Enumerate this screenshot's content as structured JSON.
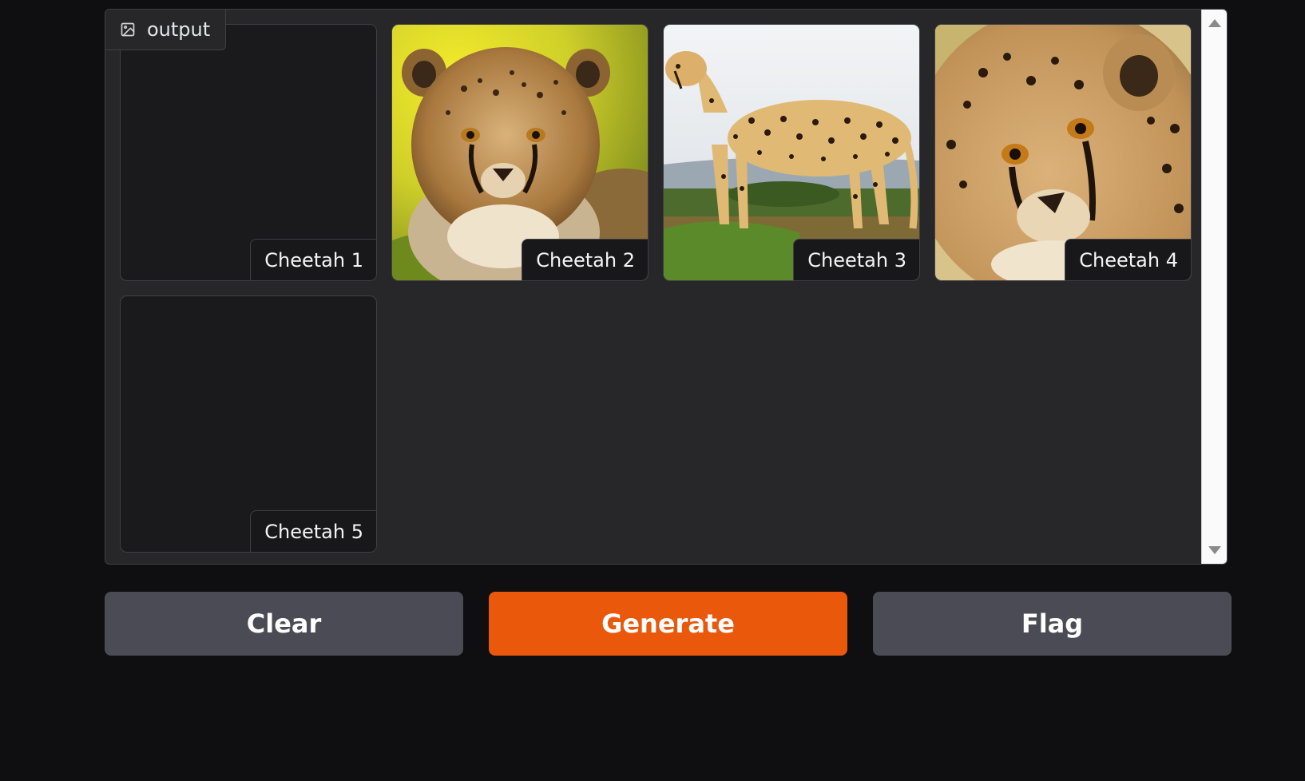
{
  "output_block": {
    "label": "output",
    "label_icon": "image-icon"
  },
  "gallery": {
    "items": [
      {
        "caption": "Cheetah 1",
        "has_image": false
      },
      {
        "caption": "Cheetah 2",
        "has_image": true,
        "image": "cheetah-cub-lying-in-grass"
      },
      {
        "caption": "Cheetah 3",
        "has_image": true,
        "image": "cheetah-standing-on-savanna"
      },
      {
        "caption": "Cheetah 4",
        "has_image": true,
        "image": "cheetah-face-closeup"
      },
      {
        "caption": "Cheetah 5",
        "has_image": false
      }
    ]
  },
  "buttons": {
    "clear": "Clear",
    "generate": "Generate",
    "flag": "Flag"
  },
  "colors": {
    "page_background": "#0f0f11",
    "panel_background": "#27272a",
    "border": "#3f3f46",
    "primary_button": "#ea580c",
    "secondary_button": "#4b4b55"
  }
}
